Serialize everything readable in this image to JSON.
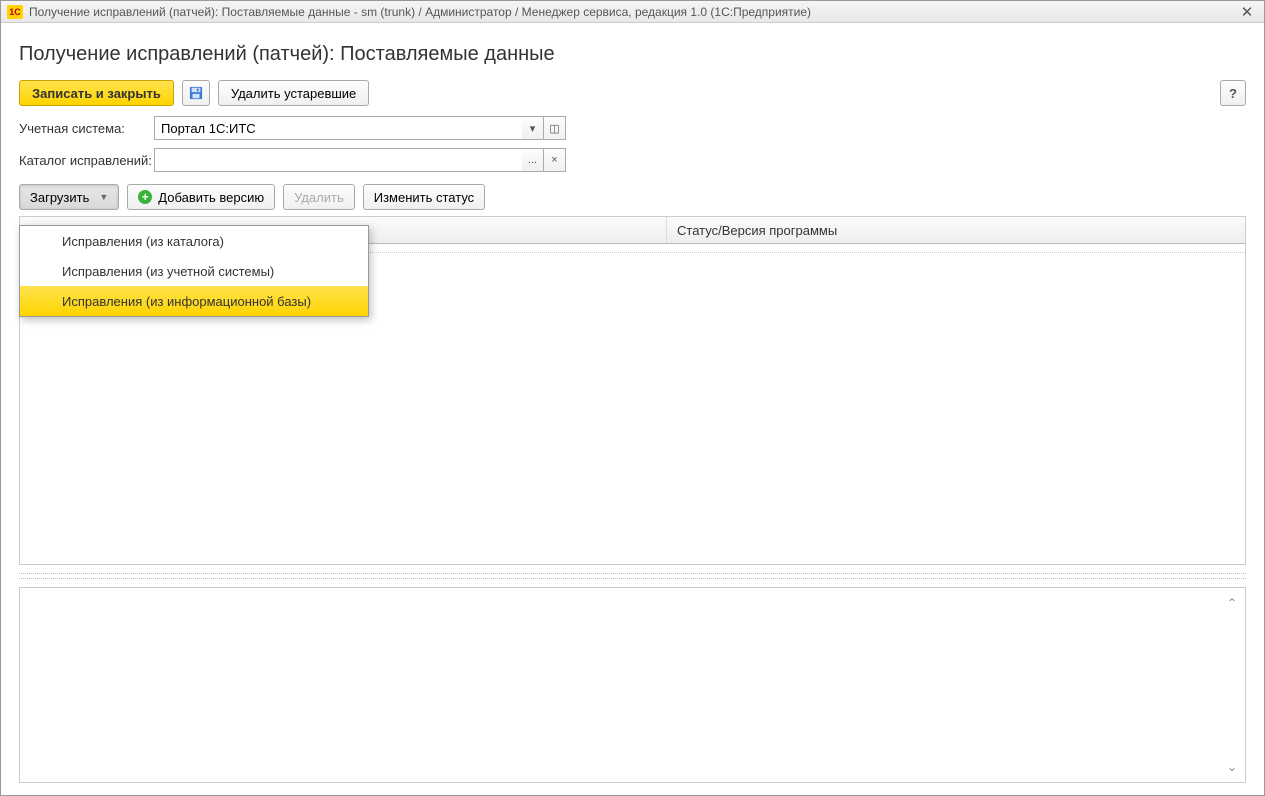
{
  "window": {
    "title": "Получение исправлений (патчей): Поставляемые данные - sm (trunk) / Администратор / Менеджер сервиса, редакция 1.0  (1С:Предприятие)",
    "logo_text": "1C"
  },
  "page": {
    "title": "Получение исправлений (патчей): Поставляемые данные"
  },
  "toolbar": {
    "save_and_close": "Записать и закрыть",
    "delete_old": "Удалить устаревшие",
    "help": "?"
  },
  "form": {
    "account_system_label": "Учетная система:",
    "account_system_value": "Портал 1С:ИТС",
    "fix_catalog_label": "Каталог исправлений:",
    "fix_catalog_value": ""
  },
  "actions": {
    "load": "Загрузить",
    "add_version": "Добавить версию",
    "delete": "Удалить",
    "change_status": "Изменить статус"
  },
  "dropdown": {
    "items": [
      {
        "label": "Исправления (из каталога)"
      },
      {
        "label": "Исправления (из учетной системы)"
      },
      {
        "label": "Исправления (из информационной базы)"
      }
    ],
    "highlighted_index": 2
  },
  "table": {
    "columns": [
      "",
      "Статус/Версия программы"
    ]
  },
  "mini_buttons": {
    "dropdown": "▾",
    "link": "◫",
    "ellipsis": "...",
    "clear": "×"
  }
}
